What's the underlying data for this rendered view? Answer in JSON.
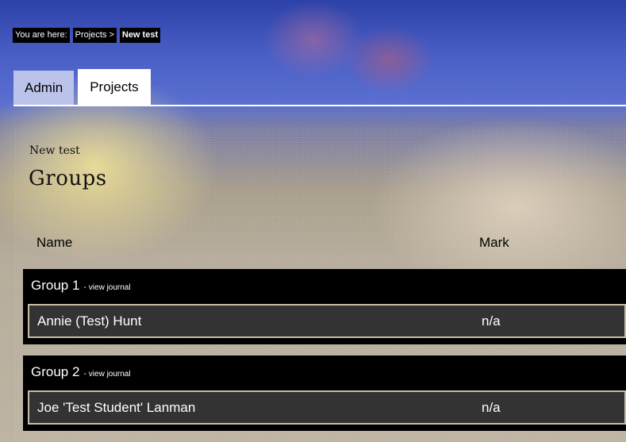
{
  "breadcrumb": {
    "prefix": "You are here:",
    "items": [
      "Projects >",
      "New test"
    ]
  },
  "tabs": [
    {
      "label": "Admin",
      "active": false
    },
    {
      "label": "Projects",
      "active": true
    }
  ],
  "page": {
    "subtitle": "New test",
    "title": "Groups"
  },
  "table": {
    "columns": [
      "Name",
      "Mark"
    ],
    "groups": [
      {
        "name": "Group 1",
        "separator": "-",
        "link": "view journal",
        "members": [
          {
            "name": "Annie (Test) Hunt",
            "mark": "n/a"
          }
        ]
      },
      {
        "name": "Group 2",
        "separator": "-",
        "link": "view journal",
        "members": [
          {
            "name": "Joe 'Test Student' Lanman",
            "mark": "n/a"
          }
        ]
      }
    ]
  },
  "colors": {
    "header_blue": "#4a5fc6",
    "tab_inactive": "#bcc3ea",
    "row_bg": "#333333",
    "group_bg": "#000000",
    "row_border": "#c9bca5"
  }
}
